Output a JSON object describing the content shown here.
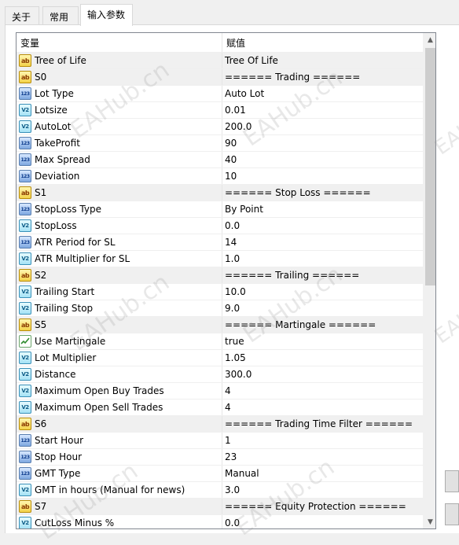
{
  "tabs": [
    {
      "label": "关于"
    },
    {
      "label": "常用"
    },
    {
      "label": "输入参数"
    }
  ],
  "grid": {
    "col_variable": "变量",
    "col_value": "赋值",
    "rows": [
      {
        "icon": "ab",
        "name": "Tree of Life",
        "value": "Tree Of Life"
      },
      {
        "icon": "ab",
        "name": "S0",
        "value": "====== Trading ======"
      },
      {
        "icon": "123",
        "name": "Lot Type",
        "value": "Auto Lot"
      },
      {
        "icon": "v2",
        "name": "Lotsize",
        "value": "0.01"
      },
      {
        "icon": "v2",
        "name": "AutoLot",
        "value": "200.0"
      },
      {
        "icon": "123",
        "name": "TakeProfit",
        "value": "90"
      },
      {
        "icon": "123",
        "name": "Max Spread",
        "value": "40"
      },
      {
        "icon": "123",
        "name": "Deviation",
        "value": "10"
      },
      {
        "icon": "ab",
        "name": "S1",
        "value": "====== Stop Loss ======"
      },
      {
        "icon": "123",
        "name": "StopLoss Type",
        "value": "By Point"
      },
      {
        "icon": "v2",
        "name": "StopLoss",
        "value": "0.0"
      },
      {
        "icon": "123",
        "name": "ATR Period for SL",
        "value": "14"
      },
      {
        "icon": "v2",
        "name": "ATR Multiplier for SL",
        "value": "1.0"
      },
      {
        "icon": "ab",
        "name": "S2",
        "value": "====== Trailing ======"
      },
      {
        "icon": "v2",
        "name": "Trailing Start",
        "value": "10.0"
      },
      {
        "icon": "v2",
        "name": "Trailing Stop",
        "value": "9.0"
      },
      {
        "icon": "ab",
        "name": "S5",
        "value": "====== Martingale ======"
      },
      {
        "icon": "bool",
        "name": "Use Martingale",
        "value": "true"
      },
      {
        "icon": "v2",
        "name": "Lot Multiplier",
        "value": "1.05"
      },
      {
        "icon": "v2",
        "name": "Distance",
        "value": "300.0"
      },
      {
        "icon": "v2",
        "name": "Maximum Open Buy Trades",
        "value": "4"
      },
      {
        "icon": "v2",
        "name": "Maximum Open Sell Trades",
        "value": "4"
      },
      {
        "icon": "ab",
        "name": "S6",
        "value": "====== Trading Time Filter ======"
      },
      {
        "icon": "123",
        "name": "Start Hour",
        "value": "1"
      },
      {
        "icon": "123",
        "name": "Stop Hour",
        "value": "23"
      },
      {
        "icon": "123",
        "name": "GMT Type",
        "value": "Manual"
      },
      {
        "icon": "v2",
        "name": "GMT in hours (Manual for news)",
        "value": "3.0"
      },
      {
        "icon": "ab",
        "name": "S7",
        "value": "====== Equity Protection ======"
      },
      {
        "icon": "v2",
        "name": "CutLoss Minus %",
        "value": "0.0"
      }
    ]
  },
  "watermark": "EAHub.cn"
}
